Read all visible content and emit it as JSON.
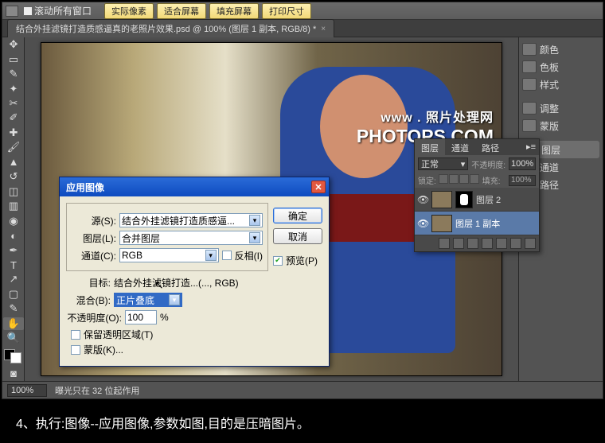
{
  "topbar": {
    "scroll_all_label": "滚动所有窗口",
    "buttons": [
      "实际像素",
      "适合屏幕",
      "填充屏幕",
      "打印尺寸"
    ]
  },
  "doc_tab": {
    "title": "结合外挂滤镜打造质感逼真的老照片效果.psd @ 100% (图层 1 副本, RGB/8) *"
  },
  "watermark": {
    "cn": "www . 照片处理网",
    "en": "PHOTOPS.COM"
  },
  "right_panels": {
    "items": [
      {
        "label": "颜色"
      },
      {
        "label": "色板"
      },
      {
        "label": "样式"
      },
      {
        "label": "调整"
      },
      {
        "label": "蒙版"
      },
      {
        "label": "图层"
      },
      {
        "label": "通道"
      },
      {
        "label": "路径"
      }
    ]
  },
  "statusbar": {
    "zoom": "100%",
    "info": "曝光只在 32 位起作用"
  },
  "dialog": {
    "title": "应用图像",
    "source_label": "源(S):",
    "source_value": "结合外挂滤镜打造质感逼...",
    "layer_label": "图层(L):",
    "layer_value": "合并图层",
    "channel_label": "通道(C):",
    "channel_value": "RGB",
    "invert_label": "反相(I)",
    "target_label": "目标:",
    "target_value": "结合外挂滤镜打造...(..., RGB)",
    "blend_label": "混合(B):",
    "blend_value": "正片叠底",
    "opacity_label": "不透明度(O):",
    "opacity_value": "100",
    "opacity_unit": "%",
    "preserve_label": "保留透明区域(T)",
    "mask_label": "蒙版(K)...",
    "ok": "确定",
    "cancel": "取消",
    "preview": "预览(P)"
  },
  "layers_panel": {
    "tabs": [
      "图层",
      "通道",
      "路径"
    ],
    "blendmode": "正常",
    "opacity_label": "不透明度:",
    "opacity_value": "100%",
    "lock_label": "锁定:",
    "fill_label": "填充:",
    "fill_value": "100%",
    "layers": [
      {
        "name": "图层 2",
        "has_mask": true
      },
      {
        "name": "图层 1 副本",
        "selected": true
      }
    ]
  },
  "caption": "4、执行:图像--应用图像,参数如图,目的是压暗图片。"
}
